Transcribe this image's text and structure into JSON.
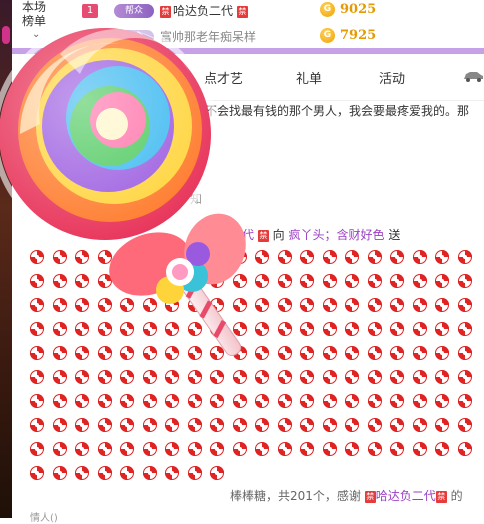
{
  "rank": {
    "label_line1": "本场",
    "label_line2": "榜单",
    "rows": [
      {
        "num": "1",
        "badge": "帮众",
        "name": "哈达负二代",
        "ban": "禁",
        "coin": "G",
        "amount": "9025"
      },
      {
        "num": "",
        "badge": "帮众",
        "name": "富帅那老年痴呆样",
        "ban": "",
        "coin": "G",
        "amount": "7925"
      }
    ]
  },
  "tabs": [
    {
      "label": "点才艺"
    },
    {
      "label": "礼单"
    },
    {
      "label": "活动"
    }
  ],
  "notice": "不会找最有钱的那个男人，我会要最疼爱我的。那",
  "faded": [
    "门",
    "知"
  ],
  "gift_line": {
    "sender": "二代",
    "ban": "禁",
    "to": "向",
    "receiver": "疯丫头；含财好色",
    "verb": "送"
  },
  "thanks_line": {
    "text": "棒棒糖，共201个，感谢",
    "ban": "禁",
    "user": "哈达负二代",
    "tail": "的"
  },
  "cutoff": "情人()",
  "icons": {
    "car": "car-icon",
    "lollipop": "lollipop-gift-icon",
    "candy": "candy-icon"
  },
  "colors": {
    "accent": "#c6a1e8",
    "coin": "#e49a00",
    "username": "#9b3fc4",
    "ban": "#e53b3b"
  }
}
